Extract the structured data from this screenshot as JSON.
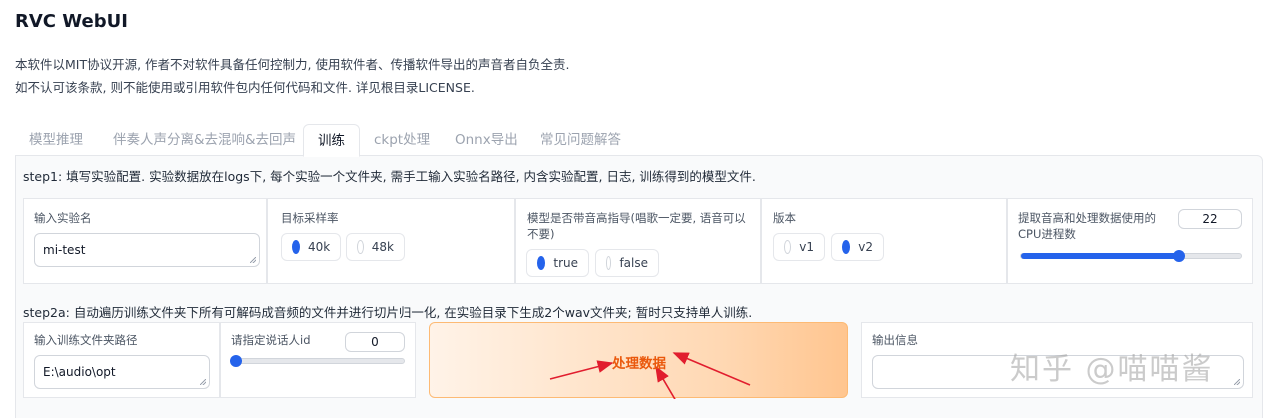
{
  "app": {
    "title": "RVC WebUI",
    "description_line1": "本软件以MIT协议开源, 作者不对软件具备任何控制力, 使用软件者、传播软件导出的声音者自负全责.",
    "description_line2": "如不认可该条款, 则不能使用或引用软件包内任何代码和文件. 详见根目录LICENSE."
  },
  "tabs": [
    {
      "label": "模型推理",
      "active": false
    },
    {
      "label": "伴奏人声分离&去混响&去回声",
      "active": false
    },
    {
      "label": "训练",
      "active": true
    },
    {
      "label": "ckpt处理",
      "active": false
    },
    {
      "label": "Onnx导出",
      "active": false
    },
    {
      "label": "常见问题解答",
      "active": false
    }
  ],
  "step1": {
    "text": "step1: 填写实验配置. 实验数据放在logs下, 每个实验一个文件夹, 需手工输入实验名路径, 内含实验配置, 日志, 训练得到的模型文件.",
    "exp_name": {
      "label": "输入实验名",
      "value": "mi-test"
    },
    "sample_rate": {
      "label": "目标采样率",
      "options": [
        "40k",
        "48k"
      ],
      "selected": "40k"
    },
    "pitch_guidance": {
      "label": "模型是否带音高指导(唱歌一定要, 语音可以不要)",
      "options": [
        "true",
        "false"
      ],
      "selected": "true"
    },
    "version": {
      "label": "版本",
      "options": [
        "v1",
        "v2"
      ],
      "selected": "v2"
    },
    "cpu_threads": {
      "label": "提取音高和处理数据使用的CPU进程数",
      "value": "22",
      "fraction": 0.72
    }
  },
  "step2a": {
    "text": "step2a: 自动遍历训练文件夹下所有可解码成音频的文件并进行切片归一化, 在实验目录下生成2个wav文件夹; 暂时只支持单人训练.",
    "train_dir": {
      "label": "输入训练文件夹路径",
      "value": "E:\\audio\\opt"
    },
    "speaker_id": {
      "label": "请指定说话人id",
      "value": "0",
      "fraction": 0.0
    },
    "process_button": "处理数据",
    "output": {
      "label": "输出信息",
      "value": ""
    }
  },
  "watermark": "知乎 @喵喵酱",
  "colors": {
    "accent": "#2563eb",
    "button_text": "#ea580c",
    "arrow": "#e11d2e"
  }
}
